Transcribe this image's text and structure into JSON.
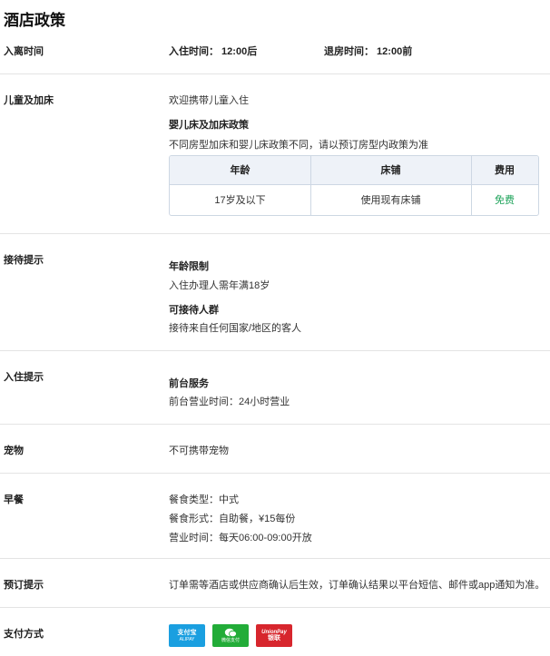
{
  "page_title": "酒店政策",
  "checkin_checkout": {
    "label": "入离时间",
    "checkin": "入住时间： 12:00后",
    "checkout": "退房时间： 12:00前"
  },
  "children_beds": {
    "label": "儿童及加床",
    "welcome": "欢迎携带儿童入住",
    "policy_title": "婴儿床及加床政策",
    "policy_note": "不同房型加床和婴儿床政策不同，请以预订房型内政策为准",
    "table": {
      "headers": [
        "年龄",
        "床铺",
        "费用"
      ],
      "rows": [
        [
          "17岁及以下",
          "使用现有床铺",
          "免费"
        ]
      ]
    }
  },
  "reception": {
    "label": "接待提示",
    "age_title": "年龄限制",
    "age_text": "入住办理人需年满18岁",
    "guests_title": "可接待人群",
    "guests_text": "接待来自任何国家/地区的客人"
  },
  "checkin_tips": {
    "label": "入住提示",
    "desk_title": "前台服务",
    "desk_text": "前台营业时间：24小时营业"
  },
  "pets": {
    "label": "宠物",
    "text": "不可携带宠物"
  },
  "breakfast": {
    "label": "早餐",
    "type": "餐食类型：中式",
    "form": "餐食形式：自助餐，¥15每份",
    "hours": "营业时间：每天06:00-09:00开放"
  },
  "booking_tips": {
    "label": "预订提示",
    "text": "订单需等酒店或供应商确认后生效，订单确认结果以平台短信、邮件或app通知为准。"
  },
  "payment": {
    "label": "支付方式",
    "methods": [
      {
        "main": "支付宝",
        "sub": "ALIPAY",
        "icon": "alipay-icon",
        "color": "#1a9fe0"
      },
      {
        "main": "微信支付",
        "sub": "",
        "icon": "wechat-pay-icon",
        "color": "#22ac38"
      },
      {
        "main": "银联",
        "sub": "UnionPay",
        "icon": "unionpay-icon",
        "color": "#d7262d"
      }
    ]
  }
}
